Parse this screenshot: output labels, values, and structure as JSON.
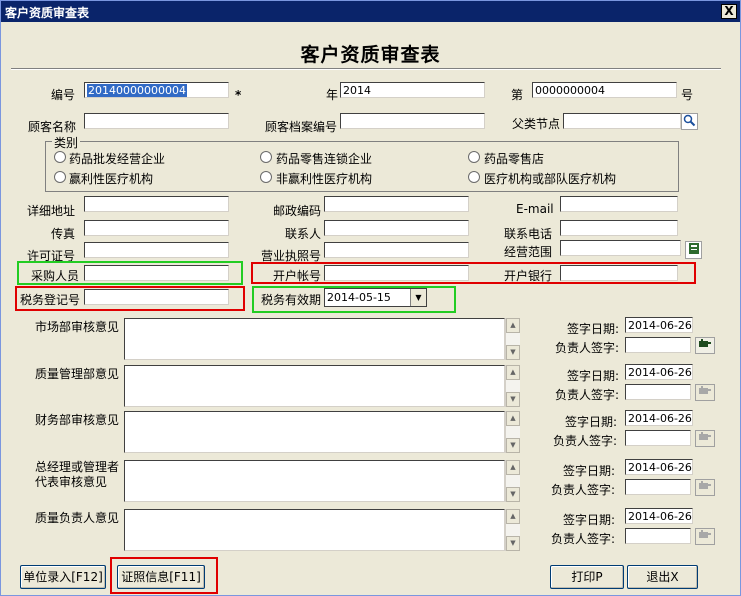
{
  "window": {
    "title": "客户资质审查表",
    "close_glyph": "X"
  },
  "form": {
    "heading": "客户资质审查表",
    "bianhao_label": "编号",
    "bianhao_value": "20140000000004",
    "asterisk": "*",
    "nian_label": "年",
    "nian_value": "2014",
    "di_label": "第",
    "di_value": "0000000004",
    "hao_label": "号",
    "customer_name_label": "顾客名称",
    "customer_name_value": "",
    "customer_file_label": "顾客档案编号",
    "customer_file_value": "",
    "parent_node_label": "父类节点",
    "parent_node_value": "",
    "category": {
      "label": "类别",
      "options": [
        "药品批发经营企业",
        "药品零售连锁企业",
        "药品零售店",
        "赢利性医疗机构",
        "非赢利性医疗机构",
        "医疗机构或部队医疗机构"
      ]
    },
    "address_label": "详细地址",
    "postcode_label": "邮政编码",
    "email_label": "E-mail",
    "fax_label": "传真",
    "contact_label": "联系人",
    "phone_label": "联系电话",
    "license_label": "许可证号",
    "bizlicense_label": "营业执照号",
    "scope_label": "经营范围",
    "buyer_label": "采购人员",
    "account_label": "开户帐号",
    "bank_label": "开户银行",
    "taxreg_label": "税务登记号",
    "taxvalid_label": "税务有效期",
    "taxvalid_value": "2014-05-15"
  },
  "reviews": [
    {
      "label": "市场部审核意见",
      "date_label": "签字日期:",
      "date_value": "2014-06-26",
      "sign_label": "负责人签字:"
    },
    {
      "label": "质量管理部意见",
      "date_label": "签字日期:",
      "date_value": "2014-06-26",
      "sign_label": "负责人签字:"
    },
    {
      "label": "财务部审核意见",
      "date_label": "签字日期:",
      "date_value": "2014-06-26",
      "sign_label": "负责人签字:"
    },
    {
      "label": "总经理或管理者代表审核意见",
      "label_line1": "总经理或管理者",
      "label_line2": "代表审核意见",
      "date_label": "签字日期:",
      "date_value": "2014-06-26",
      "sign_label": "负责人签字:"
    },
    {
      "label": "质量负责人意见",
      "date_label": "签字日期:",
      "date_value": "2014-06-26",
      "sign_label": "负责人签字:"
    }
  ],
  "buttons": {
    "unit_entry": "单位录入[F12]",
    "license_info": "证照信息[F11]",
    "print": "打印P",
    "exit": "退出X"
  },
  "colors": {
    "highlight_red": "#e00000",
    "highlight_green": "#22cc22",
    "titlebar": "#0a246a",
    "selection": "#316ac5"
  }
}
